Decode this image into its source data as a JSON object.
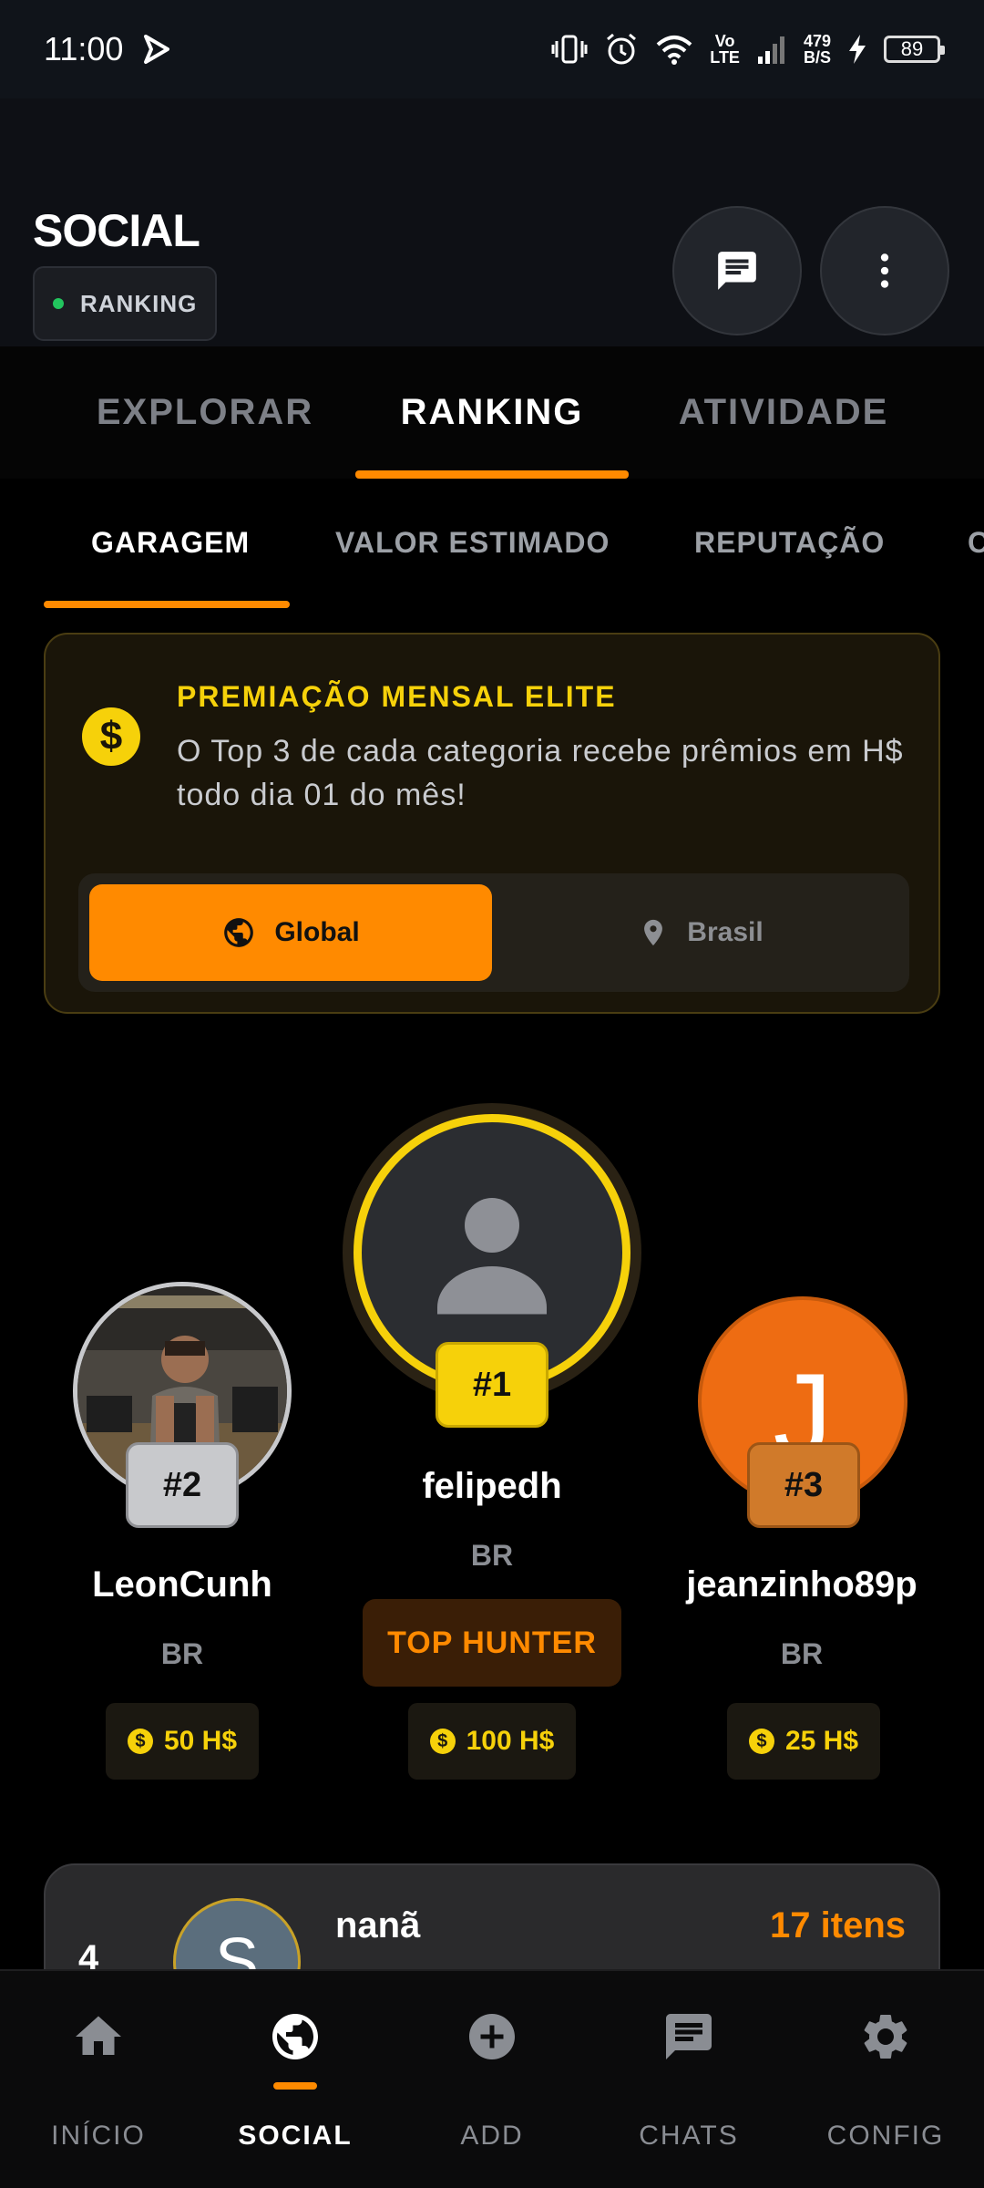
{
  "status_bar": {
    "time": "11:00",
    "network_top": "Vo",
    "network_bottom": "LTE",
    "speed_value": "479",
    "speed_unit": "B/S",
    "battery": "89"
  },
  "header": {
    "title": "SOCIAL",
    "mode_chip": "RANKING"
  },
  "main_tabs": [
    "EXPLORAR",
    "RANKING",
    "ATIVIDADE"
  ],
  "sub_tabs": [
    "GARAGEM",
    "VALOR ESTIMADO",
    "REPUTAÇÃO",
    "C"
  ],
  "award": {
    "title": "PREMIAÇÃO MENSAL ELITE",
    "text": "O Top 3 de cada categoria recebe prêmios em H$ todo dia 01 do mês!",
    "coin_symbol": "$",
    "scope_options": [
      "Global",
      "Brasil"
    ],
    "selected_scope": "Global"
  },
  "podium": {
    "first": {
      "rank": "#1",
      "name": "felipedh",
      "country": "BR",
      "badge": "TOP HUNTER",
      "prize": "100 H$"
    },
    "second": {
      "rank": "#2",
      "name": "LeonCunh",
      "country": "BR",
      "prize": "50 H$"
    },
    "third": {
      "rank": "#3",
      "name": "jeanzinho89p",
      "country": "BR",
      "prize": "25 H$",
      "initial": "J"
    }
  },
  "list": [
    {
      "position": "4",
      "initial": "S",
      "name": "nanã",
      "items": "17 itens"
    }
  ],
  "bottom_nav": [
    "INÍCIO",
    "SOCIAL",
    "ADD",
    "CHATS",
    "CONFIG"
  ],
  "colors": {
    "accent": "#ff8a00",
    "gold": "#f6d10a",
    "silver": "#c8c9cc",
    "bronze": "#d07a2a",
    "background": "#000000"
  }
}
